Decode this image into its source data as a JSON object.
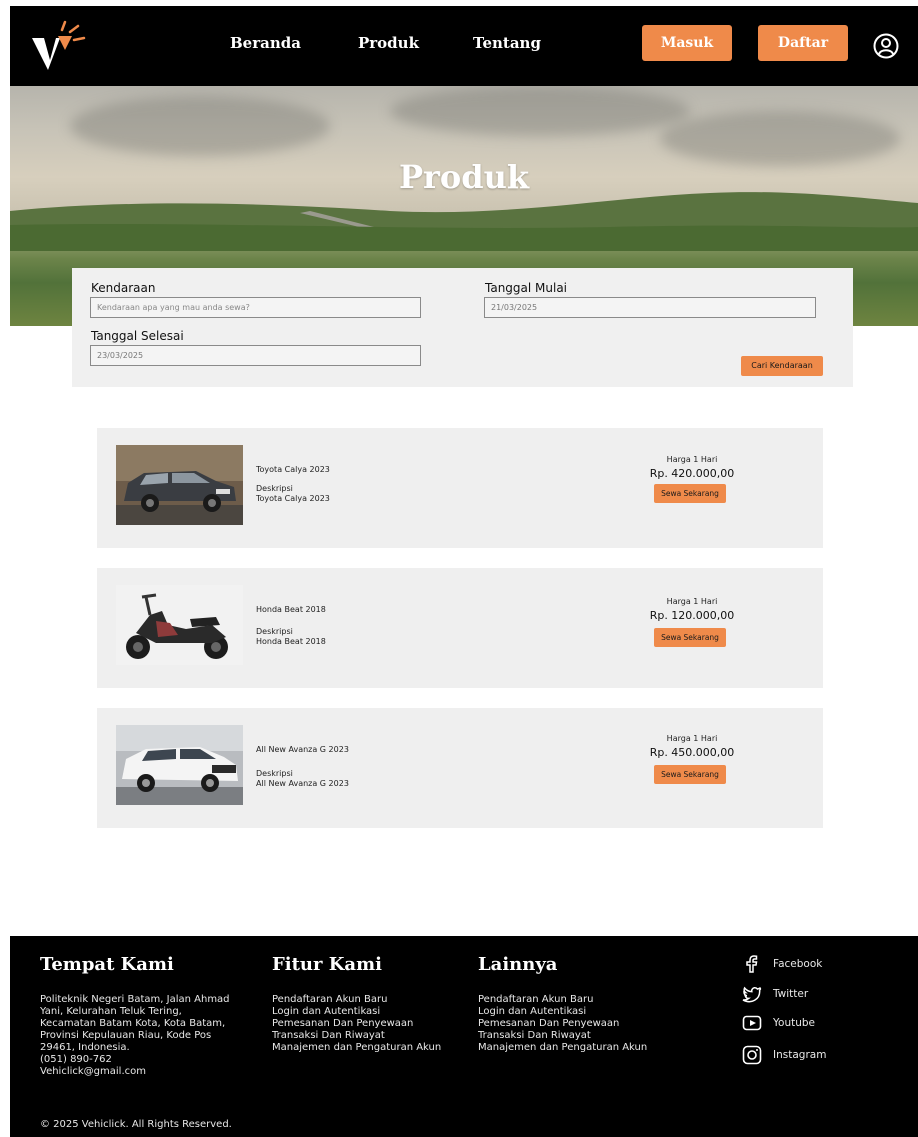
{
  "nav": {
    "links": [
      "Beranda",
      "Produk",
      "Tentang"
    ],
    "login_label": "Masuk",
    "register_label": "Daftar"
  },
  "hero": {
    "title": "Produk"
  },
  "search": {
    "vehicle_label": "Kendaraan",
    "vehicle_placeholder": "Kendaraan apa yang mau anda sewa?",
    "start_label": "Tanggal Mulai",
    "start_value": "21/03/2025",
    "end_label": "Tanggal Selesai",
    "end_value": "23/03/2025",
    "button_label": "Cari Kendaraan"
  },
  "products": [
    {
      "name": "Toyota Calya 2023",
      "desc_label": "Deskripsi",
      "desc": "Toyota Calya 2023",
      "price_label": "Harga 1 Hari",
      "price": "Rp. 420.000,00",
      "button": "Sewa Sekarang"
    },
    {
      "name": "Honda Beat 2018",
      "desc_label": "Deskripsi",
      "desc": "Honda Beat 2018",
      "price_label": "Harga 1 Hari",
      "price": "Rp. 120.000,00",
      "button": "Sewa Sekarang"
    },
    {
      "name": "All New Avanza G 2023",
      "desc_label": "Deskripsi",
      "desc": "All New Avanza G 2023",
      "price_label": "Harga 1 Hari",
      "price": "Rp. 450.000,00",
      "button": "Sewa Sekarang"
    }
  ],
  "footer": {
    "location_title": "Tempat Kami",
    "location_lines": [
      "Politeknik Negeri Batam, Jalan Ahmad",
      "Yani, Kelurahan Teluk Tering,",
      "Kecamatan Batam Kota, Kota Batam,",
      "Provinsi Kepulauan Riau, Kode Pos",
      "29461, Indonesia.",
      "(051) 890-762",
      "Vehiclick@gmail.com"
    ],
    "features_title": "Fitur Kami",
    "features_lines": [
      "Pendaftaran Akun Baru",
      "Login dan Autentikasi",
      "Pemesanan Dan Penyewaan",
      "Transaksi Dan Riwayat",
      "Manajemen dan Pengaturan Akun"
    ],
    "other_title": "Lainnya",
    "other_lines": [
      "Pendaftaran Akun Baru",
      "Login dan Autentikasi",
      "Pemesanan Dan Penyewaan",
      "Transaksi Dan Riwayat",
      "Manajemen dan Pengaturan Akun"
    ],
    "social": [
      {
        "label": "Facebook",
        "icon": "facebook-icon"
      },
      {
        "label": "Twitter",
        "icon": "twitter-icon"
      },
      {
        "label": "Youtube",
        "icon": "youtube-icon"
      },
      {
        "label": "Instagram",
        "icon": "instagram-icon"
      }
    ],
    "copyright": "© 2025 Vehiclick. All Rights Reserved."
  },
  "colors": {
    "accent": "#ef8a4a",
    "nav_bg": "#000000",
    "card_bg": "#efefef"
  }
}
